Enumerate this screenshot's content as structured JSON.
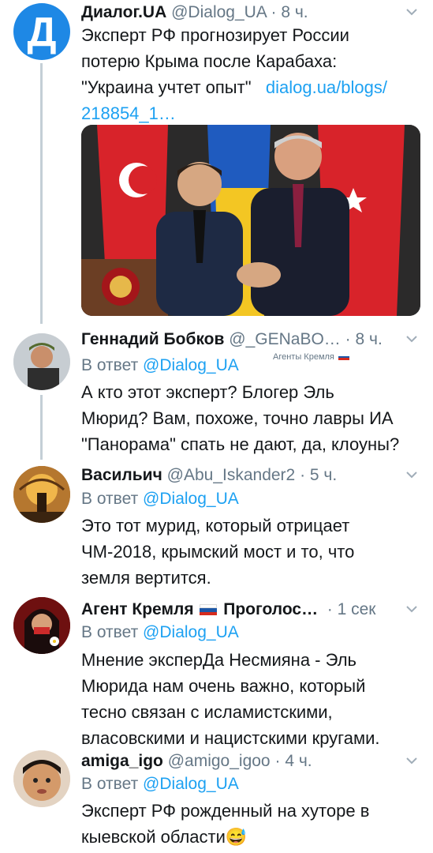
{
  "tweets": [
    {
      "name": "Диалог.UA",
      "handle": "@Dialog_UA",
      "time": "8 ч.",
      "avatar_letter": "Д",
      "text_lines": [
        "Эксперт РФ прогнозирует России",
        "потерю Крыма после Карабаха:"
      ],
      "quote_text": "\"Украина учтет опыт\"",
      "link_part1": "dialog.ua/blogs/",
      "link_part2": "218854_1…"
    },
    {
      "name": "Геннадий Бобков",
      "handle": "@_GENaBO…",
      "time": "8 ч.",
      "reply_prefix": "В ответ",
      "reply_to": "@Dialog_UA",
      "badge": "Агенты Кремля",
      "text_lines": [
        "А кто этот эксперт? Блогер Эль",
        "Мюрид? Вам, похоже, точно лавры ИА",
        "\"Панорама\" спать не дают, да, клоуны?"
      ]
    },
    {
      "name": "Васильич",
      "handle": "@Abu_Iskander2",
      "time": "5 ч.",
      "reply_prefix": "В ответ",
      "reply_to": "@Dialog_UA",
      "text_lines": [
        "Это тот мурид, который отрицает",
        "ЧМ-2018, крымский мост и то, что",
        "земля вертится."
      ]
    },
    {
      "name_a": "Агент Кремля",
      "name_b": "Проголос…",
      "time": "1 сек",
      "reply_prefix": "В ответ",
      "reply_to": "@Dialog_UA",
      "text_lines": [
        "Мнение эксперДа Несмияна - Эль",
        "Мюрида нам очень важно, который",
        "тесно связан с исламистскими,",
        "власовскими и нацистскими кругами."
      ]
    },
    {
      "name": "amiga_igo",
      "handle": "@amigo_igoo",
      "time": "4 ч.",
      "reply_prefix": "В ответ",
      "reply_to": "@Dialog_UA",
      "text_lines": [
        "Эксперт РФ рожденный на хуторе в",
        "кыевской области"
      ],
      "emoji": "😅"
    }
  ],
  "colors": {
    "accent": "#1da1f2",
    "muted": "#657786",
    "thread": "#c4cfd6"
  }
}
